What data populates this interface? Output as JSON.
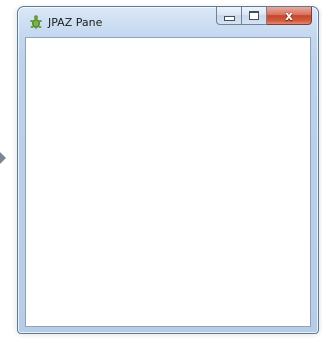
{
  "window": {
    "title": "JPAZ Pane",
    "app_icon": "turtle-icon"
  },
  "caption_buttons": {
    "minimize_icon": "minimize-icon",
    "maximize_icon": "maximize-icon",
    "close_icon": "close-icon",
    "close_glyph": "x"
  },
  "colors": {
    "titlebar": "#c4d8ef",
    "close_button": "#c7452b",
    "client_background": "#ffffff"
  }
}
